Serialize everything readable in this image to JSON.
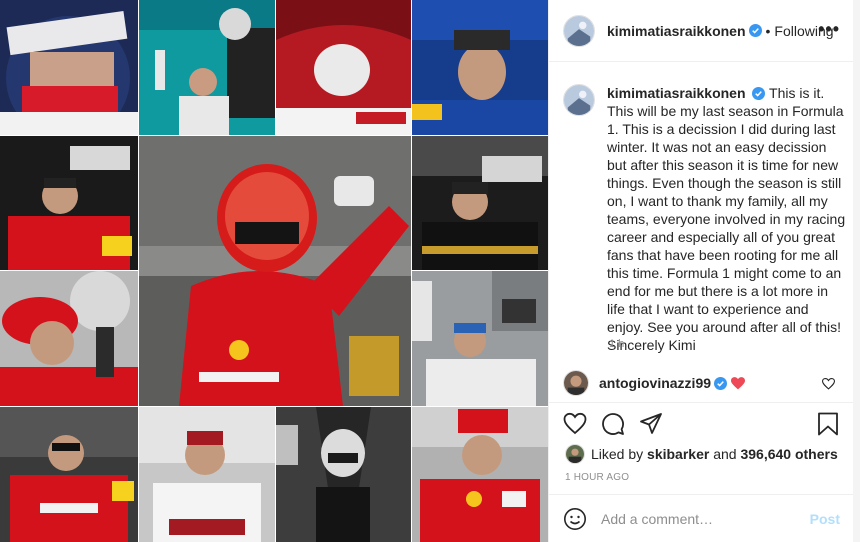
{
  "header": {
    "username": "kimimatiasraikkonen",
    "separator": "•",
    "follow_status": "Following",
    "more_glyph": "•••"
  },
  "caption": {
    "username": "kimimatiasraikkonen",
    "text": "This is it. This will be my last season in Formula 1. This is a decission I did during last winter. It was not an easy decission but after this season it is time for new things. Even though the season is still on, I want to thank my family, all my teams, everyone involved in my racing career and especially all of you great fans that have been rooting for me all this time. Formula 1 might come to an end for me but there is a lot more in life that I want to experience and enjoy. See you around after all of this! Sincerely Kimi",
    "time": "1 h"
  },
  "comment": {
    "username": "antogiovinazzi99"
  },
  "likes": {
    "prefix": "Liked by",
    "liker": "skibarker",
    "middle": "and",
    "count": "396,640 others"
  },
  "post_time": "1 HOUR AGO",
  "add_comment": {
    "placeholder": "Add a comment…",
    "post_label": "Post"
  },
  "icons": {
    "actions": [
      "heart-outline-icon",
      "comment-bubble-icon",
      "share-paper-plane-icon",
      "bookmark-icon"
    ],
    "verified": "verified-badge-icon",
    "emoji": "smiley-icon"
  },
  "colors": {
    "verified_blue": "#3897f0",
    "post_button_disabled": "#b2dffc",
    "heart_red": "#ed4956",
    "ferrari_red": "#d4121b"
  }
}
